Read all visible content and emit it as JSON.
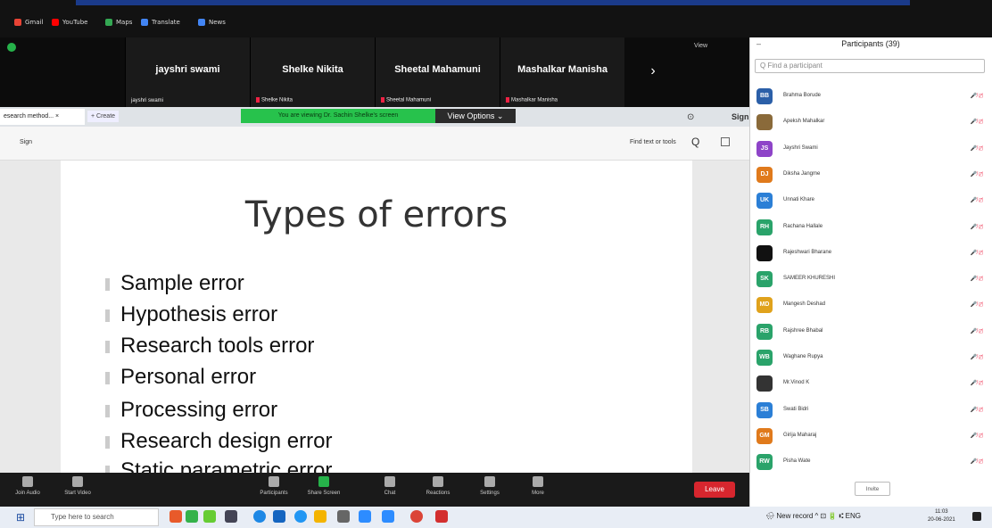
{
  "bookmarks": [
    {
      "label": "Gmail",
      "color": "#e84335"
    },
    {
      "label": "YouTube",
      "color": "#ff0000"
    },
    {
      "label": "Maps",
      "color": "#34a853"
    },
    {
      "label": "Translate",
      "color": "#4285f4"
    },
    {
      "label": "News",
      "color": "#4285f4"
    }
  ],
  "video": {
    "tiles": [
      {
        "name": "jayshri swami",
        "sub": "jayshri swami"
      },
      {
        "name": "Shelke Nikita",
        "sub": "Shelke Nikita"
      },
      {
        "name": "Sheetal Mahamuni",
        "sub": "Sheetal Mahamuni"
      },
      {
        "name": "Mashalkar Manisha",
        "sub": "Mashalkar Manisha"
      }
    ],
    "next_label": "›",
    "view_label": "View"
  },
  "tabs": {
    "active_tab": "esearch method... ×",
    "new_tab": "+ Create",
    "sign_in": "Sign"
  },
  "share": {
    "banner": "You are viewing Dr. Sachin Shelke's screen",
    "view_options": "View Options ⌄"
  },
  "doc_toolbar": {
    "sign": "Sign",
    "find": "Find text or tools",
    "search_glyph": "Q"
  },
  "slide": {
    "title": "Types of errors",
    "bullets": [
      "Sample error",
      "Hypothesis error",
      "Research tools error",
      "Personal error",
      "Processing error",
      "Research design error",
      "Static parametric error"
    ]
  },
  "zoom_toolbar": {
    "items": [
      "Join Audio",
      "Start Video",
      "Participants",
      "Share Screen",
      "Chat",
      "Reactions",
      "Settings",
      "More"
    ],
    "leave": "Leave"
  },
  "participants": {
    "title": "Participants (39)",
    "close": "–",
    "search_placeholder": "Find a participant",
    "list": [
      {
        "initials": "BB",
        "name": "Brahma Borude",
        "color": "#2b5fa8"
      },
      {
        "initials": "",
        "name": "Apeksh Mahalkar",
        "color": "#8a6a3a"
      },
      {
        "initials": "JS",
        "name": "Jayshri Swami",
        "color": "#8e44c8"
      },
      {
        "initials": "DJ",
        "name": "Diksha Jangme",
        "color": "#e07a1c"
      },
      {
        "initials": "UK",
        "name": "Unnati Khare",
        "color": "#2b7fd6"
      },
      {
        "initials": "RH",
        "name": "Rachana Hallale",
        "color": "#2aa36a"
      },
      {
        "initials": "",
        "name": "Rajeshwari Bharane",
        "color": "#111111"
      },
      {
        "initials": "SK",
        "name": "SAMEER KHURESHI",
        "color": "#2aa36a"
      },
      {
        "initials": "MD",
        "name": "Mangesh Deshad",
        "color": "#e0a21c"
      },
      {
        "initials": "RB",
        "name": "Rajshree Bhabal",
        "color": "#2aa36a"
      },
      {
        "initials": "WB",
        "name": "Waghane Rupya",
        "color": "#2aa36a"
      },
      {
        "initials": "",
        "name": "Mr.Vinod K",
        "color": "#333333"
      },
      {
        "initials": "SB",
        "name": "Swati Bidri",
        "color": "#2b7fd6"
      },
      {
        "initials": "GM",
        "name": "Girija Maharaj",
        "color": "#e07a1c"
      },
      {
        "initials": "RW",
        "name": "Pisha Wate",
        "color": "#2aa36a"
      }
    ],
    "status": "🎤̸ ◻̸",
    "invite": "Invite"
  },
  "taskbar": {
    "search_placeholder": "Type here to search",
    "tray": "🌧 New record  ^ ⊡ 🔋 ⑆ ENG",
    "clock_time": "11:03",
    "clock_date": "20-06-2021"
  }
}
